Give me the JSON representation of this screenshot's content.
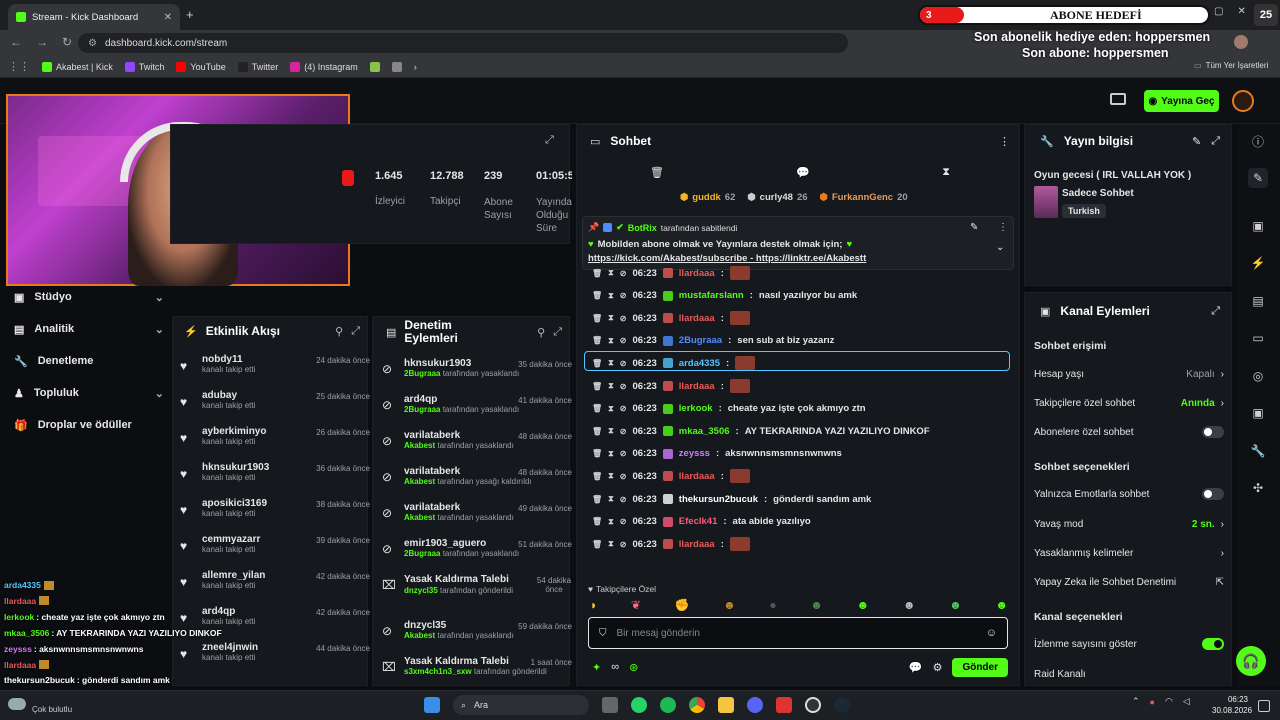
{
  "browser": {
    "tab_title": "Stream - Kick Dashboard",
    "url": "dashboard.kick.com/stream",
    "bookmarks": [
      "Akabest | Kick",
      "Twitch",
      "YouTube",
      "Twitter",
      "(4) Instagram"
    ],
    "all_bookmarks": "Tüm Yer İşaretleri"
  },
  "overlay": {
    "goal_count": "3",
    "goal_label": "ABONE HEDEFİ",
    "goal_target": "25",
    "last_gift": "Son abonelik hediye eden: hoppersmen",
    "last_sub": "Son abone: hoppersmen"
  },
  "header": {
    "go_live": "Yayına Geç"
  },
  "stats": [
    {
      "value": "1.645",
      "label": "İzleyici"
    },
    {
      "value": "12.788",
      "label": "Takipçi"
    },
    {
      "value": "239",
      "label": "Abone Sayısı"
    },
    {
      "value": "01:05:5",
      "label": "Yayında Olduğu Süre"
    }
  ],
  "nav": [
    "Stüdyo",
    "Analitik",
    "Denetleme",
    "Topluluk",
    "Droplar ve ödüller"
  ],
  "activity": {
    "title": "Etkinlik Akışı",
    "items": [
      {
        "name": "nobdy11",
        "sub": "kanalı takip etti",
        "time": "24 dakika önce"
      },
      {
        "name": "adubay",
        "sub": "kanalı takip etti",
        "time": "25 dakika önce"
      },
      {
        "name": "ayberkiminyo",
        "sub": "kanalı takip etti",
        "time": "26 dakika önce"
      },
      {
        "name": "hknsukur1903",
        "sub": "kanalı takip etti",
        "time": "36 dakika önce"
      },
      {
        "name": "aposikici3169",
        "sub": "kanalı takip etti",
        "time": "38 dakika önce"
      },
      {
        "name": "cemmyazarr",
        "sub": "kanalı takip etti",
        "time": "39 dakika önce"
      },
      {
        "name": "allemre_yilan",
        "sub": "kanalı takip etti",
        "time": "42 dakika önce"
      },
      {
        "name": "ard4qp",
        "sub": "kanalı takip etti",
        "time": "42 dakika önce"
      },
      {
        "name": "zneel4jnwin",
        "sub": "kanalı takip etti",
        "time": "44 dakika önce"
      }
    ]
  },
  "moderation": {
    "title": "Denetim Eylemleri",
    "items": [
      {
        "name": "hknsukur1903",
        "by": "2Bugraaa",
        "act": "tarafından yasaklandı",
        "time": "35 dakika önce"
      },
      {
        "name": "ard4qp",
        "by": "2Bugraaa",
        "act": "tarafından yasaklandı",
        "time": "41 dakika önce"
      },
      {
        "name": "varilataberk",
        "by": "Akabest",
        "act": "tarafından yasaklandı",
        "time": "48 dakika önce"
      },
      {
        "name": "varilataberk",
        "by": "Akabest",
        "act": "tarafından yasağı kaldırıldı",
        "time": "48 dakika önce"
      },
      {
        "name": "varilataberk",
        "by": "Akabest",
        "act": "tarafından yasaklandı",
        "time": "49 dakika önce"
      },
      {
        "name": "emir1903_aguero",
        "by": "2Bugraaa",
        "act": "tarafından yasaklandı",
        "time": "51 dakika önce"
      },
      {
        "name": "Yasak Kaldırma Talebi",
        "by": "dnzycl35",
        "act": "tarafından gönderildi",
        "time": "54 dakika önce"
      },
      {
        "name": "dnzycl35",
        "by": "Akabest",
        "act": "tarafından yasaklandı",
        "time": "59 dakika önce"
      },
      {
        "name": "Yasak Kaldırma Talebi",
        "by": "s3xm4ch1n3_sxw",
        "act": "tarafından gönderildi",
        "time": "1 saat önce"
      }
    ]
  },
  "chat": {
    "title": "Sohbet",
    "top_gifters": [
      {
        "name": "guddk",
        "count": "62"
      },
      {
        "name": "curly48",
        "count": "26"
      },
      {
        "name": "FurkannGenc",
        "count": "20"
      }
    ],
    "pinned": {
      "by": "BotRix",
      "by_suffix": "tarafından sabitlendi",
      "text": "Mobilden abone olmak ve Yayınlara destek olmak için;",
      "link1": "https://kick.com/Akabest/subscribe",
      "sep": " - ",
      "link2": "https://linktr.ee/Akabestt"
    },
    "messages": [
      {
        "time": "06:23",
        "user": "llardaaa",
        "color": "#e85a5a",
        "text": "",
        "emote": true
      },
      {
        "time": "06:23",
        "user": "mustafarslann",
        "color": "#53fc18",
        "text": "nasıl yazılıyor bu amk",
        "emote": false
      },
      {
        "time": "06:23",
        "user": "llardaaa",
        "color": "#e85a5a",
        "text": "",
        "emote": true
      },
      {
        "time": "06:23",
        "user": "2Bugraaa",
        "color": "#4e8cff",
        "text": "sen sub at biz yazarız",
        "emote": false
      },
      {
        "time": "06:23",
        "user": "arda4335",
        "color": "#53c7ff",
        "text": "",
        "emote": true
      },
      {
        "time": "06:23",
        "user": "llardaaa",
        "color": "#e85a5a",
        "text": "",
        "emote": true
      },
      {
        "time": "06:23",
        "user": "lerkook",
        "color": "#53fc18",
        "text": "cheate yaz işte çok akmıyo ztn",
        "emote": false
      },
      {
        "time": "06:23",
        "user": "mkaa_3506",
        "color": "#53fc18",
        "text": "AY TEKRARINDA YAZI YAZILIYO DINKOF",
        "emote": false
      },
      {
        "time": "06:23",
        "user": "zeysss",
        "color": "#d17cff",
        "text": "aksnwnnsmsmnsnwnwns",
        "emote": false
      },
      {
        "time": "06:23",
        "user": "llardaaa",
        "color": "#e85a5a",
        "text": "",
        "emote": true
      },
      {
        "time": "06:23",
        "user": "thekursun2bucuk",
        "color": "#ffffff",
        "text": "gönderdi sandım amk",
        "emote": false
      },
      {
        "time": "06:23",
        "user": "Efeclk41",
        "color": "#ff5a7a",
        "text": "ata abide yazılıyo",
        "emote": false
      },
      {
        "time": "06:23",
        "user": "llardaaa",
        "color": "#e85a5a",
        "text": "",
        "emote": true
      }
    ],
    "followers_only": "Takipçilere Özel",
    "input_placeholder": "Bir mesaj gönderin",
    "send": "Gönder"
  },
  "stream_info": {
    "title": "Yayın bilgisi",
    "stream_title": "Oyun gecesi ( IRL VALLAH YOK )",
    "category": "Sadece Sohbet",
    "language": "Turkish"
  },
  "channel_actions": {
    "title": "Kanal Eylemleri",
    "chat_access": "Sohbet erişimi",
    "account_age": "Hesap yaşı",
    "account_age_val": "Kapalı",
    "followers_chat": "Takipçilere özel sohbet",
    "followers_chat_val": "Anında",
    "subs_chat": "Abonelere özel sohbet",
    "chat_options": "Sohbet seçenekleri",
    "emotes_only": "Yalnızca Emotlarla sohbet",
    "slow_mode": "Yavaş mod",
    "slow_mode_val": "2 sn.",
    "banned_words": "Yasaklanmış kelimeler",
    "ai_mod": "Yapay Zeka ile Sohbet Denetimi",
    "channel_options": "Kanal seçenekleri",
    "show_views": "İzlenme sayısını göster",
    "raid": "Raid Kanalı"
  },
  "overlay_chat": [
    {
      "user": "arda4335",
      "color": "#53c7ff",
      "text": ""
    },
    {
      "user": "llardaaa",
      "color": "#e85a5a",
      "text": ""
    },
    {
      "user": "lerkook",
      "color": "#53fc18",
      "text": ": cheate yaz işte çok akmıyo ztn"
    },
    {
      "user": "mkaa_3506",
      "color": "#53fc18",
      "text": ": AY TEKRARINDA YAZI YAZILIYO DINKOF"
    },
    {
      "user": "zeysss",
      "color": "#d17cff",
      "text": ": aksnwnnsmsmnsnwnwns"
    },
    {
      "user": "llardaaa",
      "color": "#e85a5a",
      "text": ""
    },
    {
      "user": "thekursun2bucuk",
      "color": "#ffffff",
      "text": ": gönderdi sandım amk"
    },
    {
      "user": "Efeclk41",
      "color": "#ff5a7a",
      "text": ": ata abide yazılıyo"
    }
  ],
  "taskbar": {
    "search": "Ara",
    "weather": "Çok bulutlu",
    "time": "06:23",
    "date": "30.08.2026"
  },
  "colors": {
    "accent": "#53fc18",
    "panel": "#15181c",
    "bg": "#0b0d10"
  }
}
